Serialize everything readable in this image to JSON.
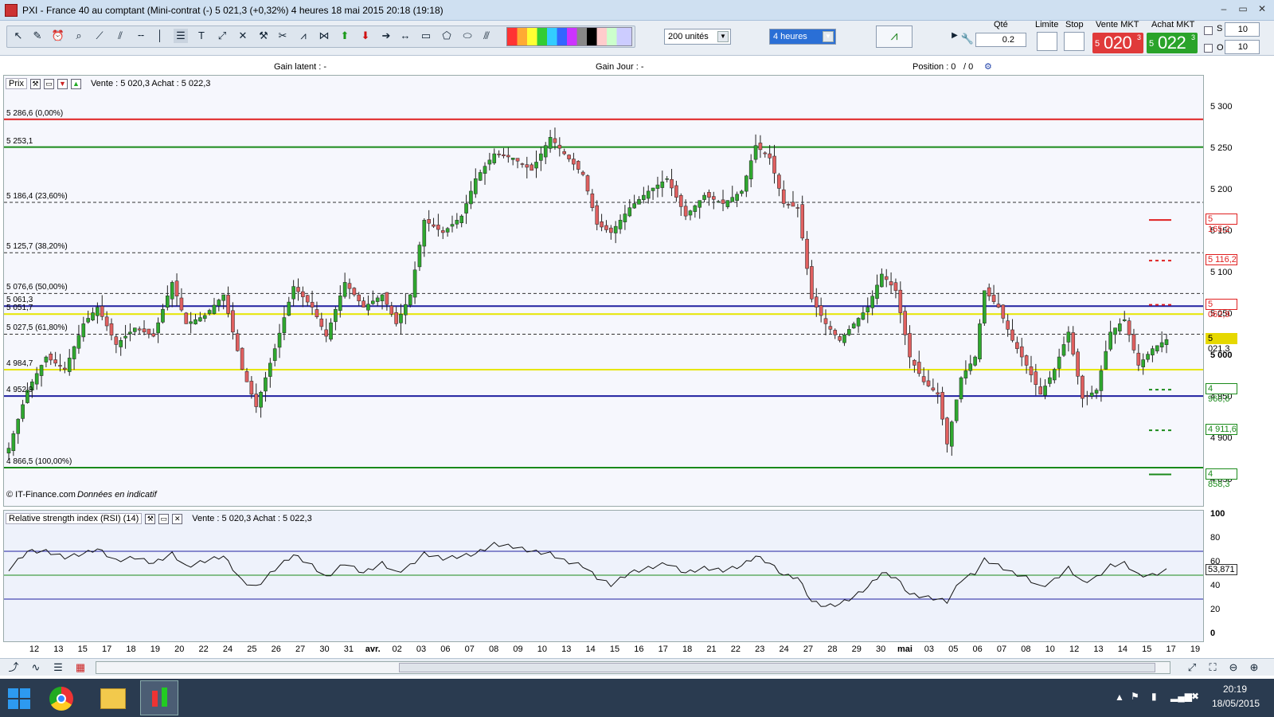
{
  "window": {
    "title": "PXI - France 40 au comptant (Mini-contrat  (-)   5 021,3 (+0,32%)     4 heures   18 mai 2015 20:18 (19:18)",
    "btn_min": "–",
    "btn_max": "▭",
    "btn_close": "✕"
  },
  "toolbar": {
    "units_select": "200 unités",
    "period_select": "4 heures",
    "qty_label": "Qté",
    "qty_value": "0.2",
    "limit_label": "Limite",
    "stop_label": "Stop",
    "sell_label": "Vente MKT",
    "buy_label": "Achat MKT",
    "sell_small": "5",
    "sell_big": "020",
    "sell_sup": "3",
    "buy_small": "5",
    "buy_big": "022",
    "buy_sup": "3",
    "s_label": "S",
    "o_label": "O",
    "s_value": "10",
    "o_value": "10"
  },
  "info": {
    "gain_latent": "Gain latent : -",
    "gain_jour": "Gain Jour : -",
    "position": "Position : 0",
    "position2": "/ 0"
  },
  "price_panel": {
    "name": "Prix",
    "quote": "Vente : 5 020,3 Achat : 5 022,3",
    "copyright": "© IT-Finance.com",
    "disclaimer": "Données en indicatif",
    "levels": [
      {
        "label": "5 286,6 (0,00%)",
        "price": 5286.6,
        "color": "#e02020",
        "style": "solid"
      },
      {
        "label": "5 253,1",
        "price": 5253.1,
        "color": "#1a8a1a",
        "style": "solid"
      },
      {
        "label": "5 186,4 (23,60%)",
        "price": 5186.4,
        "color": "#333333",
        "style": "dash"
      },
      {
        "label": "5 125,7 (38,20%)",
        "price": 5125.7,
        "color": "#333333",
        "style": "dash"
      },
      {
        "label": "5 076,6 (50,00%)",
        "price": 5076.6,
        "color": "#333333",
        "style": "dash"
      },
      {
        "label": "5 061,3",
        "price": 5061.3,
        "color": "#2020a0",
        "style": "solid"
      },
      {
        "label": "5 051,7",
        "price": 5051.7,
        "color": "#e6e600",
        "style": "solid"
      },
      {
        "label": "5 027,5 (61,80%)",
        "price": 5027.5,
        "color": "#333333",
        "style": "dash"
      },
      {
        "label": "4 984,7",
        "price": 4984.7,
        "color": "#e6e600",
        "style": "solid"
      },
      {
        "label": "4 952,9",
        "price": 4952.9,
        "color": "#2020a0",
        "style": "solid"
      },
      {
        "label": "4 866,5 (100,00%)",
        "price": 4866.5,
        "color": "#1a8a1a",
        "style": "solid"
      }
    ],
    "y_ticks": [
      "5 300",
      "5 250",
      "5 200",
      "5 150",
      "5 100",
      "5 050",
      "5 000",
      "4 950",
      "4 900",
      "4 850"
    ],
    "y_tick_values": [
      5300,
      5250,
      5200,
      5150,
      5100,
      5050,
      5000,
      4950,
      4900,
      4850
    ],
    "tags": [
      {
        "text": "5 165,2",
        "price": 5165.2,
        "color": "#e02020"
      },
      {
        "text": "5 116,2",
        "price": 5116.2,
        "color": "#e02020"
      },
      {
        "text": "5 062,9",
        "price": 5062.9,
        "color": "#e02020"
      },
      {
        "text": "5 021,3",
        "price": 5021.3,
        "color": "#e6d800",
        "filled": true
      },
      {
        "text": "4 960,6",
        "price": 4960.6,
        "color": "#1a8a1a"
      },
      {
        "text": "4 911,6",
        "price": 4911.6,
        "color": "#1a8a1a"
      },
      {
        "text": "4 858,3",
        "price": 4858.3,
        "color": "#1a8a1a"
      }
    ]
  },
  "rsi_panel": {
    "name": "Relative strength index (RSI) (14)",
    "quote": "Vente : 5 020,3 Achat : 5 022,3",
    "y_ticks": [
      "100",
      "80",
      "60",
      "40",
      "20",
      "0"
    ],
    "last_value": "53,871",
    "upper": 70,
    "mid": 50,
    "lower": 30
  },
  "x_ticks": [
    "12",
    "13",
    "15",
    "17",
    "18",
    "19",
    "20",
    "22",
    "24",
    "25",
    "26",
    "27",
    "30",
    "31",
    "avr.",
    "02",
    "03",
    "06",
    "07",
    "08",
    "09",
    "10",
    "13",
    "14",
    "15",
    "16",
    "17",
    "18",
    "21",
    "22",
    "23",
    "24",
    "27",
    "28",
    "29",
    "30",
    "mai",
    "03",
    "05",
    "06",
    "07",
    "08",
    "10",
    "12",
    "13",
    "14",
    "15",
    "17",
    "19"
  ],
  "taskbar": {
    "time": "20:19",
    "date": "18/05/2015"
  },
  "chart_data": {
    "type": "candlestick",
    "instrument": "PXI - France 40 au comptant",
    "period": "4 heures",
    "y_range": [
      4830,
      5320
    ],
    "close_anchors": [
      [
        0,
        4890
      ],
      [
        4,
        4960
      ],
      [
        8,
        5000
      ],
      [
        12,
        4985
      ],
      [
        16,
        5040
      ],
      [
        19,
        5060
      ],
      [
        23,
        5015
      ],
      [
        27,
        5035
      ],
      [
        31,
        5025
      ],
      [
        35,
        5090
      ],
      [
        38,
        5040
      ],
      [
        42,
        5050
      ],
      [
        46,
        5075
      ],
      [
        50,
        4985
      ],
      [
        53,
        4940
      ],
      [
        57,
        5010
      ],
      [
        61,
        5085
      ],
      [
        65,
        5060
      ],
      [
        68,
        5025
      ],
      [
        72,
        5090
      ],
      [
        76,
        5060
      ],
      [
        80,
        5075
      ],
      [
        83,
        5040
      ],
      [
        86,
        5075
      ],
      [
        89,
        5165
      ],
      [
        93,
        5150
      ],
      [
        97,
        5170
      ],
      [
        100,
        5215
      ],
      [
        104,
        5245
      ],
      [
        108,
        5240
      ],
      [
        112,
        5225
      ],
      [
        116,
        5265
      ],
      [
        119,
        5245
      ],
      [
        123,
        5220
      ],
      [
        126,
        5160
      ],
      [
        129,
        5150
      ],
      [
        133,
        5180
      ],
      [
        137,
        5200
      ],
      [
        141,
        5215
      ],
      [
        145,
        5170
      ],
      [
        149,
        5195
      ],
      [
        153,
        5185
      ],
      [
        157,
        5200
      ],
      [
        160,
        5255
      ],
      [
        163,
        5240
      ],
      [
        166,
        5185
      ],
      [
        169,
        5180
      ],
      [
        172,
        5070
      ],
      [
        175,
        5040
      ],
      [
        178,
        5020
      ],
      [
        181,
        5040
      ],
      [
        184,
        5060
      ],
      [
        187,
        5100
      ],
      [
        190,
        5080
      ],
      [
        193,
        5000
      ],
      [
        196,
        4970
      ],
      [
        199,
        4955
      ],
      [
        201,
        4895
      ],
      [
        204,
        4975
      ],
      [
        207,
        5000
      ],
      [
        209,
        5080
      ],
      [
        212,
        5060
      ],
      [
        215,
        5020
      ],
      [
        218,
        4990
      ],
      [
        221,
        4955
      ],
      [
        224,
        4985
      ],
      [
        227,
        5030
      ],
      [
        230,
        4950
      ],
      [
        233,
        4960
      ],
      [
        236,
        5030
      ],
      [
        239,
        5045
      ],
      [
        242,
        4990
      ],
      [
        245,
        5010
      ],
      [
        248,
        5021
      ]
    ],
    "rsi_anchors": [
      [
        0,
        55
      ],
      [
        4,
        70
      ],
      [
        8,
        70
      ],
      [
        12,
        65
      ],
      [
        16,
        68
      ],
      [
        19,
        72
      ],
      [
        23,
        62
      ],
      [
        27,
        65
      ],
      [
        31,
        60
      ],
      [
        35,
        68
      ],
      [
        38,
        57
      ],
      [
        42,
        62
      ],
      [
        46,
        66
      ],
      [
        50,
        45
      ],
      [
        53,
        40
      ],
      [
        57,
        55
      ],
      [
        61,
        67
      ],
      [
        65,
        58
      ],
      [
        68,
        48
      ],
      [
        72,
        60
      ],
      [
        76,
        52
      ],
      [
        80,
        60
      ],
      [
        83,
        52
      ],
      [
        86,
        58
      ],
      [
        89,
        68
      ],
      [
        93,
        64
      ],
      [
        97,
        66
      ],
      [
        100,
        68
      ],
      [
        104,
        76
      ],
      [
        108,
        74
      ],
      [
        112,
        70
      ],
      [
        116,
        68
      ],
      [
        119,
        62
      ],
      [
        123,
        58
      ],
      [
        126,
        48
      ],
      [
        129,
        42
      ],
      [
        133,
        52
      ],
      [
        137,
        56
      ],
      [
        141,
        60
      ],
      [
        145,
        52
      ],
      [
        149,
        56
      ],
      [
        153,
        54
      ],
      [
        157,
        58
      ],
      [
        160,
        66
      ],
      [
        163,
        60
      ],
      [
        166,
        50
      ],
      [
        169,
        48
      ],
      [
        172,
        28
      ],
      [
        175,
        24
      ],
      [
        178,
        26
      ],
      [
        181,
        32
      ],
      [
        184,
        40
      ],
      [
        187,
        52
      ],
      [
        190,
        48
      ],
      [
        193,
        34
      ],
      [
        196,
        32
      ],
      [
        199,
        30
      ],
      [
        201,
        28
      ],
      [
        204,
        46
      ],
      [
        207,
        52
      ],
      [
        209,
        63
      ],
      [
        212,
        58
      ],
      [
        215,
        52
      ],
      [
        218,
        48
      ],
      [
        221,
        40
      ],
      [
        224,
        46
      ],
      [
        227,
        56
      ],
      [
        230,
        44
      ],
      [
        233,
        48
      ],
      [
        236,
        58
      ],
      [
        239,
        60
      ],
      [
        242,
        50
      ],
      [
        245,
        50
      ],
      [
        248,
        54
      ]
    ],
    "last_close": 5021.3
  }
}
